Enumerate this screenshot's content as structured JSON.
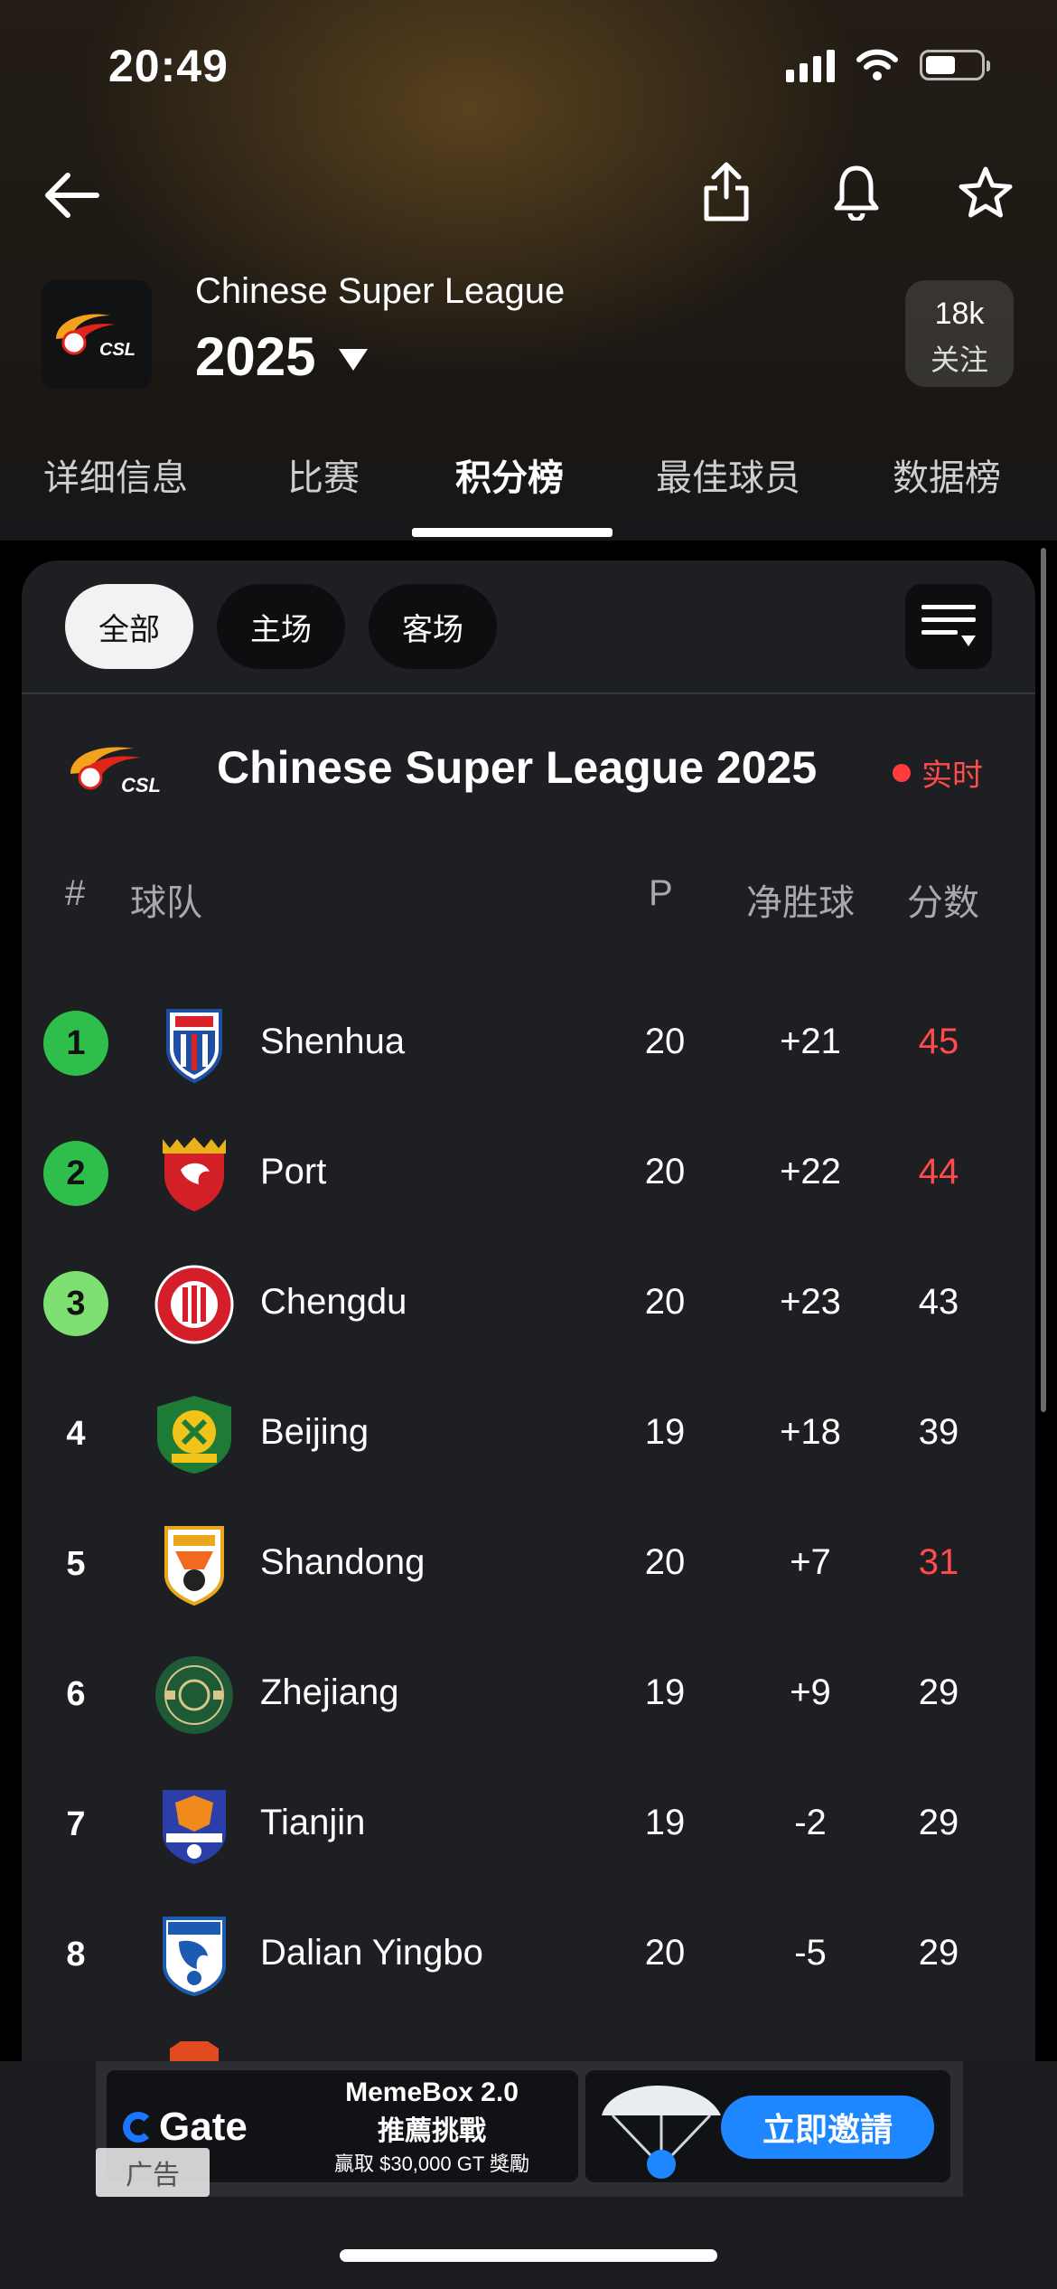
{
  "status_bar": {
    "time": "20:49"
  },
  "header": {
    "league_name": "Chinese Super League",
    "season": "2025",
    "logo_text": "CSL",
    "follow_count": "18k",
    "follow_label": "关注"
  },
  "tabs": [
    "详细信息",
    "比赛",
    "积分榜",
    "最佳球员",
    "数据榜"
  ],
  "active_tab": "积分榜",
  "filters": [
    "全部",
    "主场",
    "客场"
  ],
  "active_filter": "全部",
  "table": {
    "title": "Chinese Super League 2025",
    "live_label": "实时",
    "columns": {
      "rank": "#",
      "team": "球队",
      "played": "P",
      "gd": "净胜球",
      "pts": "分数"
    },
    "rows": [
      {
        "rank": "1",
        "team": "Shenhua",
        "p": "20",
        "gd": "+21",
        "pts": "45",
        "pts_red": true,
        "badge": "green"
      },
      {
        "rank": "2",
        "team": "Port",
        "p": "20",
        "gd": "+22",
        "pts": "44",
        "pts_red": true,
        "badge": "green"
      },
      {
        "rank": "3",
        "team": "Chengdu",
        "p": "20",
        "gd": "+23",
        "pts": "43",
        "pts_red": false,
        "badge": "lightgreen"
      },
      {
        "rank": "4",
        "team": "Beijing",
        "p": "19",
        "gd": "+18",
        "pts": "39",
        "pts_red": false,
        "badge": "none"
      },
      {
        "rank": "5",
        "team": "Shandong",
        "p": "20",
        "gd": "+7",
        "pts": "31",
        "pts_red": true,
        "badge": "none"
      },
      {
        "rank": "6",
        "team": "Zhejiang",
        "p": "19",
        "gd": "+9",
        "pts": "29",
        "pts_red": false,
        "badge": "none"
      },
      {
        "rank": "7",
        "team": "Tianjin",
        "p": "19",
        "gd": "-2",
        "pts": "29",
        "pts_red": false,
        "badge": "none"
      },
      {
        "rank": "8",
        "team": "Dalian Yingbo",
        "p": "20",
        "gd": "-5",
        "pts": "29",
        "pts_red": false,
        "badge": "none"
      }
    ]
  },
  "ad": {
    "brand": "Gate",
    "line1": "MemeBox 2.0",
    "line2": "推薦挑戰",
    "line3": "贏取 $30,000 GT 獎勵",
    "cta": "立即邀請",
    "badge": "广告"
  },
  "colors": {
    "red": "#ff4b4b",
    "green": "#2fbe4c",
    "light_green": "#7ee070"
  }
}
